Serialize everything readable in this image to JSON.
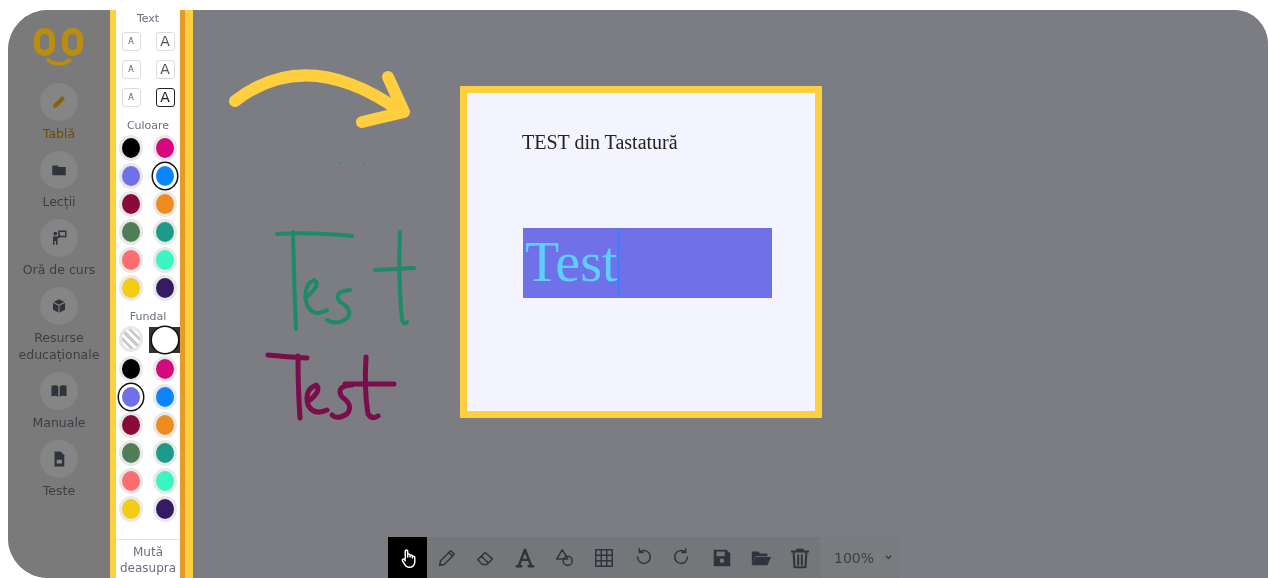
{
  "sidebar": {
    "items": [
      {
        "label": "Tablă",
        "selected": true
      },
      {
        "label": "Lecții",
        "selected": false
      },
      {
        "label": "Oră de curs",
        "selected": false
      },
      {
        "label": "Resurse educaționale",
        "selected": false
      },
      {
        "label": "Manuale",
        "selected": false
      },
      {
        "label": "Teste",
        "selected": false
      }
    ]
  },
  "panel": {
    "text_title": "Text",
    "text_sizes": [
      {
        "label": "A",
        "selected": false
      },
      {
        "label": "A",
        "selected": false
      },
      {
        "label": "A",
        "selected": false
      },
      {
        "label": "A",
        "selected": false
      },
      {
        "label": "A",
        "selected": false
      },
      {
        "label": "A",
        "selected": true
      }
    ],
    "color_title": "Culoare",
    "colors": [
      {
        "color": "#000000",
        "selected": false
      },
      {
        "color": "#d6087e",
        "selected": false
      },
      {
        "color": "#7070e8",
        "selected": false
      },
      {
        "color": "#0a84ff",
        "selected": true
      },
      {
        "color": "#8a0b3a",
        "selected": false
      },
      {
        "color": "#ef8c1e",
        "selected": false
      },
      {
        "color": "#4f7d56",
        "selected": false
      },
      {
        "color": "#1c9a8a",
        "selected": false
      },
      {
        "color": "#ff6e6e",
        "selected": false
      },
      {
        "color": "#3cf5c4",
        "selected": false
      },
      {
        "color": "#f5cc14",
        "selected": false
      },
      {
        "color": "#361a63",
        "selected": false
      }
    ],
    "background_title": "Fundal",
    "backgrounds": [
      {
        "kind": "transparent",
        "selected": false
      },
      {
        "kind": "swatch",
        "color": "#ffffff",
        "selected": true
      },
      {
        "kind": "swatch",
        "color": "#000000",
        "selected": false
      },
      {
        "kind": "swatch",
        "color": "#d6087e",
        "selected": false
      },
      {
        "kind": "swatch",
        "color": "#7070e8",
        "selected": true
      },
      {
        "kind": "swatch",
        "color": "#0a84ff",
        "selected": false
      },
      {
        "kind": "swatch",
        "color": "#8a0b3a",
        "selected": false
      },
      {
        "kind": "swatch",
        "color": "#ef8c1e",
        "selected": false
      },
      {
        "kind": "swatch",
        "color": "#4f7d56",
        "selected": false
      },
      {
        "kind": "swatch",
        "color": "#1c9a8a",
        "selected": false
      },
      {
        "kind": "swatch",
        "color": "#ff6e6e",
        "selected": false
      },
      {
        "kind": "swatch",
        "color": "#3cf5c4",
        "selected": false
      },
      {
        "kind": "swatch",
        "color": "#f5cc14",
        "selected": false
      },
      {
        "kind": "swatch",
        "color": "#361a63",
        "selected": false
      }
    ],
    "bring_front": "Mută deasupra"
  },
  "canvas": {
    "text_box": {
      "heading": "TEST din Tastatură",
      "selected_text": "Test"
    }
  },
  "toolbar": {
    "tools": [
      {
        "selected": true
      },
      {
        "selected": false
      },
      {
        "selected": false
      },
      {
        "selected": false
      },
      {
        "selected": false
      },
      {
        "selected": false
      },
      {
        "selected": false
      },
      {
        "selected": false
      },
      {
        "selected": false
      },
      {
        "selected": false
      },
      {
        "selected": false
      }
    ],
    "zoom": "100%"
  }
}
